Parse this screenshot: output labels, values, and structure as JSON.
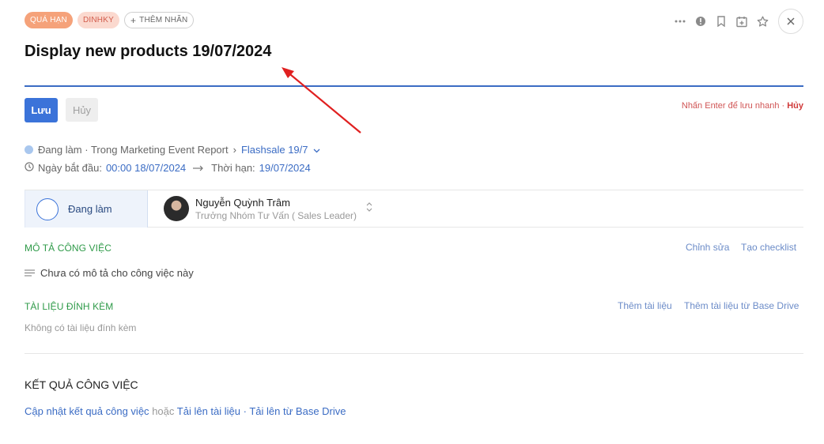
{
  "tags": {
    "overdue": "QUÁ HẠN",
    "recurring": "DINHKY",
    "add_label": "THÊM NHÃN"
  },
  "icons": [
    "more-icon",
    "alert-icon",
    "bookmark-icon",
    "calendar-add-icon",
    "star-icon",
    "close-icon"
  ],
  "task": {
    "title": "Display new products 19/07/2024"
  },
  "editor": {
    "save_label": "Lưu",
    "cancel_label": "Hủy",
    "hint_text": "Nhấn Enter để lưu nhanh ·",
    "hint_cancel": "Hủy"
  },
  "meta": {
    "status_text": "Đang làm · Trong Marketing Event Report",
    "separator": "›",
    "project": "Flashsale 19/7",
    "start_label": "Ngày bắt đầu:",
    "start_value": "00:00 18/07/2024",
    "deadline_label": "Thời hạn:",
    "deadline_value": "19/07/2024"
  },
  "status": {
    "label": "Đang làm"
  },
  "assignee": {
    "name": "Nguyễn Quỳnh Trâm",
    "role": "Trưởng Nhóm Tư Vấn ( Sales Leader)"
  },
  "description": {
    "title": "MÔ TẢ CÔNG VIỆC",
    "edit_link": "Chỉnh sửa",
    "checklist_link": "Tạo checklist",
    "empty_text": "Chưa có mô tả cho công việc này"
  },
  "attachments": {
    "title": "TÀI LIỆU ĐÍNH KÈM",
    "add_link": "Thêm tài liệu",
    "drive_link": "Thêm tài liệu từ Base Drive",
    "empty_text": "Không có tài liệu đính kèm"
  },
  "result": {
    "title": "KẾT QUẢ CÔNG VIỆC",
    "update_link": "Cập nhật kết quả công việc",
    "or_text": "hoặc",
    "upload_link": "Tải lên tài liệu",
    "dot": "·",
    "drive_link": "Tải lên từ Base Drive"
  },
  "colors": {
    "accent": "#3b73d9",
    "green_heading": "#2e9a48",
    "overdue_tag": "#f5a27a",
    "annotation_arrow": "#e02020"
  }
}
